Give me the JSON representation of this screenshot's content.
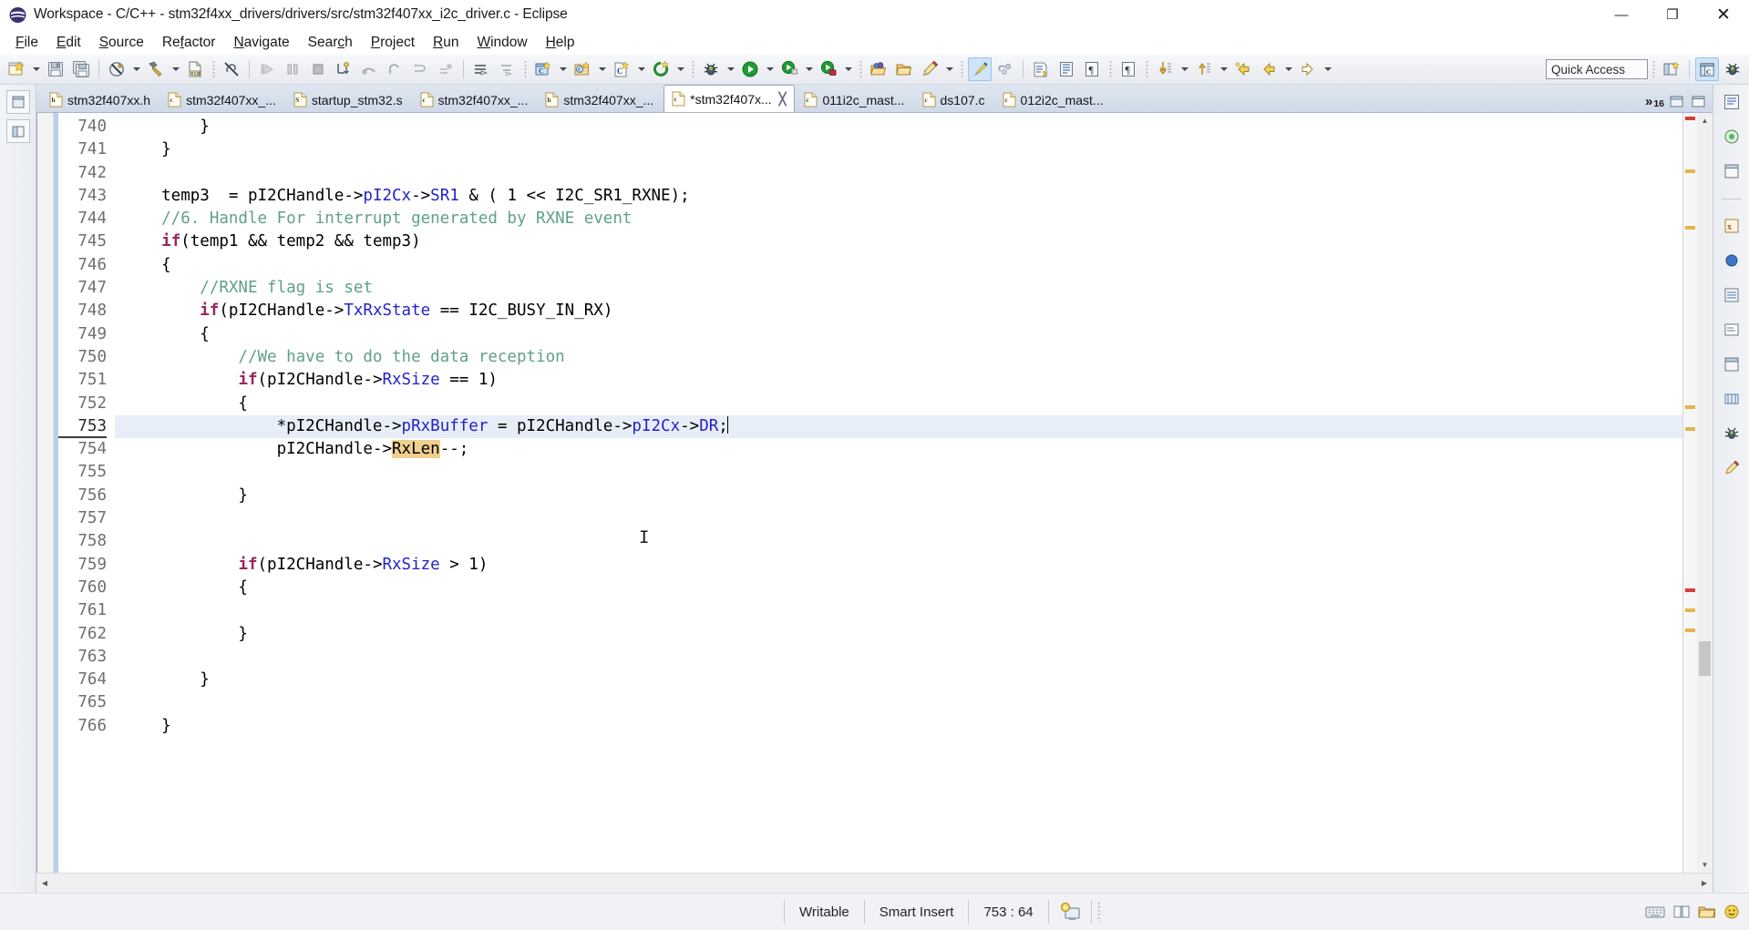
{
  "window": {
    "title": "Workspace - C/C++ - stm32f4xx_drivers/drivers/src/stm32f407xx_i2c_driver.c - Eclipse",
    "app_icon": "eclipse-icon",
    "minimize_label": "—",
    "maximize_label": "❐",
    "close_label": "✕"
  },
  "menubar": {
    "items": [
      {
        "label": "File",
        "mnemonic": "F"
      },
      {
        "label": "Edit",
        "mnemonic": "E"
      },
      {
        "label": "Source",
        "mnemonic": "S"
      },
      {
        "label": "Refactor",
        "mnemonic": "R"
      },
      {
        "label": "Navigate",
        "mnemonic": "N"
      },
      {
        "label": "Search",
        "mnemonic": "c"
      },
      {
        "label": "Project",
        "mnemonic": "P"
      },
      {
        "label": "Run",
        "mnemonic": "R"
      },
      {
        "label": "Window",
        "mnemonic": "W"
      },
      {
        "label": "Help",
        "mnemonic": "H"
      }
    ]
  },
  "toolbar": {
    "quick_access_label": "Quick Access",
    "buttons": [
      "new-wizard-icon",
      "save-icon",
      "save-all-icon",
      "build-all-icon",
      "build-hammer-icon",
      "binary-010-icon",
      "link-break-icon",
      "resume-icon",
      "suspend-icon",
      "terminate-icon",
      "step-into-icon",
      "step-over-icon",
      "step-return-icon",
      "drop-to-frame-icon",
      "use-step-filters-icon",
      "open-declaration-icon",
      "open-type-hierarchy-icon",
      "new-c-project-icon",
      "new-cpp-class-icon",
      "new-c-file-icon",
      "new-element-icon",
      "debug-icon",
      "run-icon",
      "external-tools-icon",
      "profile-icon",
      "open-folder-icon",
      "search-folder-icon",
      "pencil-icon",
      "toggle-mark-occurrences-icon",
      "toggle-block-selection-icon",
      "next-annotation-icon",
      "previous-annotation-icon",
      "show-whitespace-icon",
      "show-source-quick-icon",
      "jump-down-icon",
      "jump-up-icon",
      "back-history-icon",
      "forward-history-icon",
      "perspective-new-icon",
      "perspective-cpp-icon",
      "perspective-debug-icon"
    ]
  },
  "tabs": {
    "items": [
      {
        "label": "stm32f407xx.h",
        "kind": "h",
        "active": false,
        "dirty": false
      },
      {
        "label": "stm32f407xx_...",
        "kind": "c",
        "active": false,
        "dirty": false
      },
      {
        "label": "startup_stm32.s",
        "kind": "S",
        "active": false,
        "dirty": false
      },
      {
        "label": "stm32f407xx_...",
        "kind": "c",
        "active": false,
        "dirty": false
      },
      {
        "label": "stm32f407xx_...",
        "kind": "h",
        "active": false,
        "dirty": false
      },
      {
        "label": "*stm32f407x...",
        "kind": "c",
        "active": true,
        "dirty": true,
        "close_glyph": "╳"
      },
      {
        "label": "011i2c_mast...",
        "kind": "c",
        "active": false,
        "dirty": false
      },
      {
        "label": "ds107.c",
        "kind": "c",
        "active": false,
        "dirty": false
      },
      {
        "label": "012i2c_mast...",
        "kind": "c",
        "active": false,
        "dirty": false
      }
    ],
    "overflow_glyph": "»",
    "overflow_count": "16"
  },
  "editor": {
    "first_line": 740,
    "current_line": 753,
    "caret_line_index": 13,
    "lines": [
      {
        "num": "740",
        "tokens": [
          {
            "t": "        }",
            "c": ""
          }
        ]
      },
      {
        "num": "741",
        "tokens": [
          {
            "t": "    }",
            "c": ""
          }
        ]
      },
      {
        "num": "742",
        "tokens": [
          {
            "t": "",
            "c": ""
          }
        ]
      },
      {
        "num": "743",
        "tokens": [
          {
            "t": "    temp3  = pI2CHandle->",
            "c": ""
          },
          {
            "t": "pI2Cx",
            "c": "fld"
          },
          {
            "t": "->",
            "c": ""
          },
          {
            "t": "SR1",
            "c": "fld"
          },
          {
            "t": " & ( 1 << I2C_SR1_RXNE);",
            "c": ""
          }
        ]
      },
      {
        "num": "744",
        "tokens": [
          {
            "t": "    //6. Handle For interrupt generated by RXNE event",
            "c": "cmt"
          }
        ]
      },
      {
        "num": "745",
        "tokens": [
          {
            "t": "    ",
            "c": ""
          },
          {
            "t": "if",
            "c": "kw"
          },
          {
            "t": "(temp1 && temp2 && temp3)",
            "c": ""
          }
        ]
      },
      {
        "num": "746",
        "tokens": [
          {
            "t": "    {",
            "c": ""
          }
        ]
      },
      {
        "num": "747",
        "tokens": [
          {
            "t": "        //RXNE flag is set",
            "c": "cmt"
          }
        ]
      },
      {
        "num": "748",
        "tokens": [
          {
            "t": "        ",
            "c": ""
          },
          {
            "t": "if",
            "c": "kw"
          },
          {
            "t": "(pI2CHandle->",
            "c": ""
          },
          {
            "t": "TxRxState",
            "c": "fld"
          },
          {
            "t": " == I2C_BUSY_IN_RX)",
            "c": ""
          }
        ]
      },
      {
        "num": "749",
        "tokens": [
          {
            "t": "        {",
            "c": ""
          }
        ]
      },
      {
        "num": "750",
        "tokens": [
          {
            "t": "            //We have to do the data reception",
            "c": "cmt"
          }
        ]
      },
      {
        "num": "751",
        "tokens": [
          {
            "t": "            ",
            "c": ""
          },
          {
            "t": "if",
            "c": "kw"
          },
          {
            "t": "(pI2CHandle->",
            "c": ""
          },
          {
            "t": "RxSize",
            "c": "fld"
          },
          {
            "t": " == 1)",
            "c": ""
          }
        ]
      },
      {
        "num": "752",
        "tokens": [
          {
            "t": "            {",
            "c": ""
          }
        ]
      },
      {
        "num": "753",
        "highlight": true,
        "caret_at_end": true,
        "tokens": [
          {
            "t": "                *pI2CHandle->",
            "c": ""
          },
          {
            "t": "pRxBuffer",
            "c": "fld"
          },
          {
            "t": " = pI2CHandle->",
            "c": ""
          },
          {
            "t": "pI2Cx",
            "c": "fld"
          },
          {
            "t": "->",
            "c": ""
          },
          {
            "t": "DR",
            "c": "fld"
          },
          {
            "t": ";",
            "c": ""
          }
        ]
      },
      {
        "num": "754",
        "tokens": [
          {
            "t": "                pI2CHandle->",
            "c": ""
          },
          {
            "t": "RxLen",
            "c": "mark"
          },
          {
            "t": "--;",
            "c": ""
          }
        ]
      },
      {
        "num": "755",
        "tokens": [
          {
            "t": "",
            "c": ""
          }
        ]
      },
      {
        "num": "756",
        "tokens": [
          {
            "t": "            }",
            "c": ""
          }
        ]
      },
      {
        "num": "757",
        "tokens": [
          {
            "t": "",
            "c": ""
          }
        ]
      },
      {
        "num": "758",
        "tokens": [
          {
            "t": "",
            "c": ""
          }
        ]
      },
      {
        "num": "759",
        "tokens": [
          {
            "t": "            ",
            "c": ""
          },
          {
            "t": "if",
            "c": "kw"
          },
          {
            "t": "(pI2CHandle->",
            "c": ""
          },
          {
            "t": "RxSize",
            "c": "fld"
          },
          {
            "t": " > 1)",
            "c": ""
          }
        ]
      },
      {
        "num": "760",
        "tokens": [
          {
            "t": "            {",
            "c": ""
          }
        ]
      },
      {
        "num": "761",
        "tokens": [
          {
            "t": "",
            "c": ""
          }
        ]
      },
      {
        "num": "762",
        "tokens": [
          {
            "t": "            }",
            "c": ""
          }
        ]
      },
      {
        "num": "763",
        "tokens": [
          {
            "t": "",
            "c": ""
          }
        ]
      },
      {
        "num": "764",
        "tokens": [
          {
            "t": "        }",
            "c": ""
          }
        ]
      },
      {
        "num": "765",
        "tokens": [
          {
            "t": "",
            "c": ""
          }
        ]
      },
      {
        "num": "766",
        "tokens": [
          {
            "t": "    }",
            "c": ""
          }
        ]
      }
    ]
  },
  "statusbar": {
    "writable": "Writable",
    "insert_mode": "Smart Insert",
    "position": "753 : 64",
    "build_icon": "build-indicator-icon"
  },
  "colors": {
    "keyword": "#9c2560",
    "field": "#2323c8",
    "comment": "#60a08a",
    "occurrence_highlight": "#f0d090",
    "current_line": "#e8eef8",
    "tab_active_bg": "#ffffff",
    "tabbar_bg": "#cfd9e8",
    "toolbar_bg": "#eef0f4",
    "statusbar_bg": "#f2f2f6"
  }
}
